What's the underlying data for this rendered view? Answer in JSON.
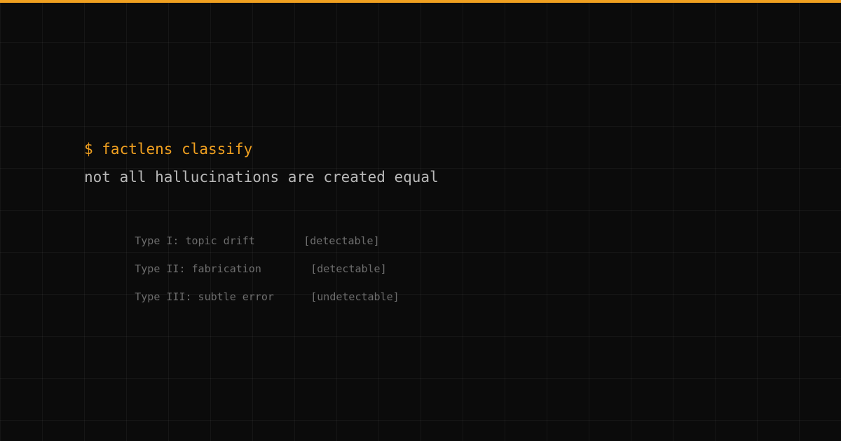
{
  "theme": {
    "accent": "#f0a020",
    "background": "#0b0b0b",
    "text_primary": "#b8b8b8",
    "text_muted": "#6e6e6e"
  },
  "terminal": {
    "command": "$ factlens classify",
    "tagline": "not all hallucinations are created equal",
    "types": [
      {
        "label": "Type I: topic drift",
        "status": "[detectable]"
      },
      {
        "label": "Type II: fabrication",
        "status": "[detectable]"
      },
      {
        "label": "Type III: subtle error",
        "status": "[undetectable]"
      }
    ]
  }
}
